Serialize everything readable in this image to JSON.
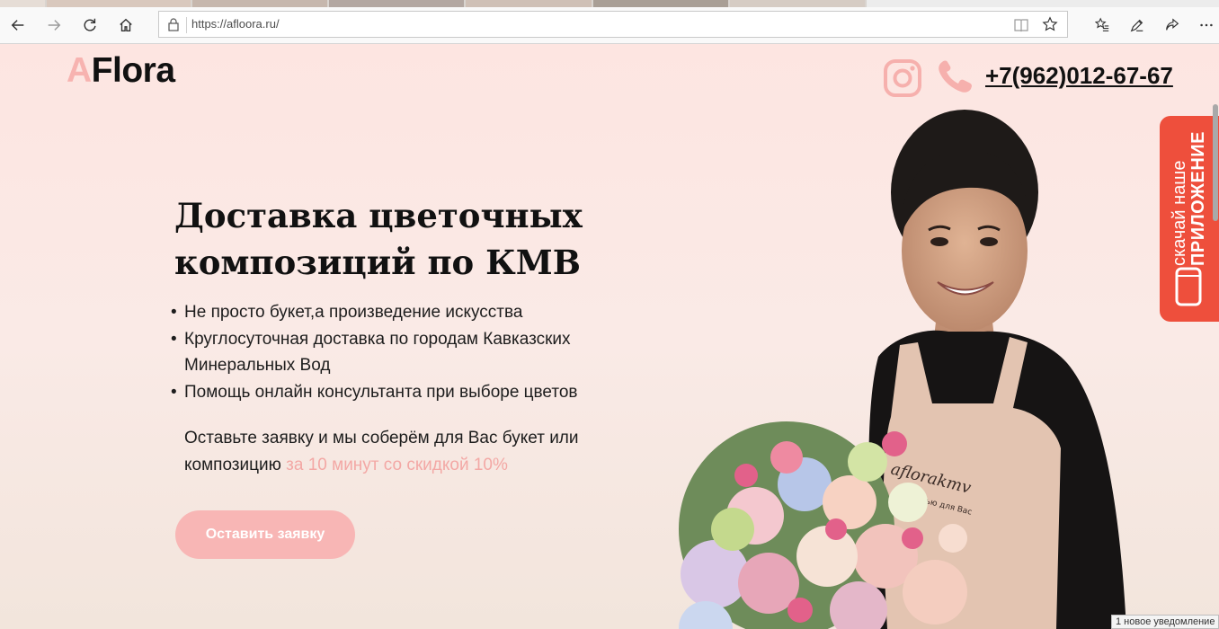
{
  "browser": {
    "url": "https://afloora.ru/",
    "icons": [
      "back-icon",
      "forward-icon",
      "refresh-icon",
      "home-icon",
      "lock-icon",
      "reading-view-icon",
      "favorite-star-icon",
      "favorites-list-icon",
      "pen-icon",
      "share-icon",
      "more-icon"
    ]
  },
  "header": {
    "logo_accent": "A",
    "logo_rest": "Flora",
    "phone": "+7(962)012-67-67"
  },
  "hero": {
    "title": "Доставка цветочных композиций по КМВ",
    "bullets": [
      "Не просто букет,а произведение искусства",
      "Круглосуточная доставка по городам Кавказских Минеральных Вод",
      "Помощь онлайн консультанта при выборе цветов"
    ],
    "offer_text": "Оставьте заявку и мы соберём для Вас букет или композицию ",
    "offer_highlight": "за 10 минут со скидкой 10%",
    "cta_label": "Оставить заявку"
  },
  "app_banner": {
    "line1": "скачай наше",
    "line2": "ПРИЛОЖЕНИЕ"
  },
  "photo": {
    "apron_text": "aflorakmv",
    "apron_subtext": "с любовью для Вас"
  },
  "notification": "1 новое уведомление",
  "colors": {
    "accent_pink": "#f7b3b0",
    "cta_pink": "#f8b6b5",
    "banner_red": "#ee4f3c",
    "page_bg_top": "#fde5e1"
  }
}
